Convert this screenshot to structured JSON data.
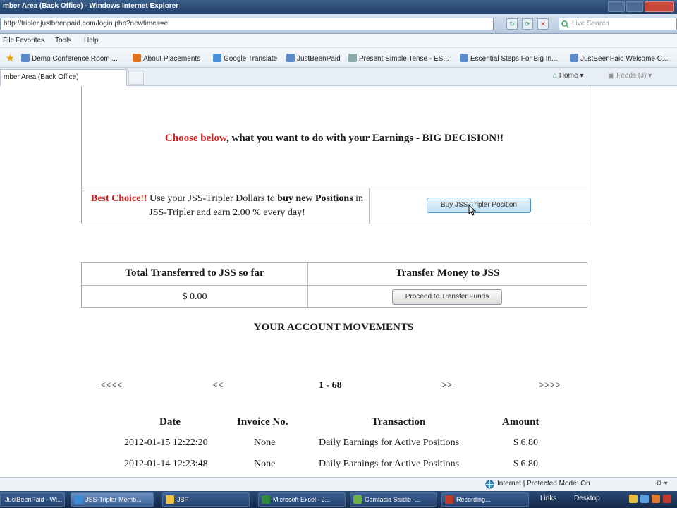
{
  "browser": {
    "title": "mber Area (Back Office) - Windows Internet Explorer",
    "address": "http://tripler.justbeenpaid.com/login.php?newtimes=el",
    "search_placeholder": "Live Search",
    "menu": [
      "File",
      "Favorites",
      "Tools",
      "Help"
    ],
    "favorites": [
      "Demo Conference Room ...",
      "About Placements",
      "Google Translate",
      "JustBeenPaid",
      "Present Simple Tense - ES...",
      "Essential Steps For Big In...",
      "JustBeenPaid Welcome C..."
    ],
    "tab_label": "mber Area (Back Office)",
    "commands": {
      "home": "Home",
      "feeds": "Feeds (J)"
    },
    "status": {
      "zone": "Internet | Protected Mode: On"
    }
  },
  "decision": {
    "headline_red": "Choose below",
    "headline_rest": ", what you want to do with your Earnings - BIG DECISION!!",
    "best_red": "Best Choice!!",
    "best_text1": " Use your JSS-Tripler Dollars to ",
    "best_bold1": "buy new Positions",
    "best_text2": " in JSS-Tripler and earn 2.00 % every day!",
    "buy_button": "Buy JSS-Tripler Position"
  },
  "transfer": {
    "total_header": "Total Transferred to JSS so far",
    "total_value": "$ 0.00",
    "transfer_header": "Transfer Money to JSS",
    "proceed_button": "Proceed to Transfer Funds"
  },
  "movements": {
    "title": "YOUR ACCOUNT MOVEMENTS",
    "pager": {
      "first": "<<<<",
      "prev": "<<",
      "range": "1 - 68",
      "next": ">>",
      "last": ">>>>"
    },
    "columns": [
      "Date",
      "Invoice No.",
      "Transaction",
      "Amount"
    ],
    "rows": [
      [
        "2012-01-15 12:22:20",
        "None",
        "Daily Earnings for Active Positions",
        "$ 6.80"
      ],
      [
        "2012-01-14 12:23:48",
        "None",
        "Daily Earnings for Active Positions",
        "$ 6.80"
      ]
    ]
  },
  "taskbar": {
    "items": [
      "JustBeenPaid - Wi...",
      "JSS-Tripler Memb...",
      "JBP",
      "Microsoft Excel - J...",
      "Camtasia Studio -...",
      "Recording..."
    ],
    "links": "Links",
    "desktop": "Desktop"
  },
  "colors": {
    "accent_red": "#d42020",
    "titlebar": "#22406a",
    "taskbar": "#13284a"
  }
}
